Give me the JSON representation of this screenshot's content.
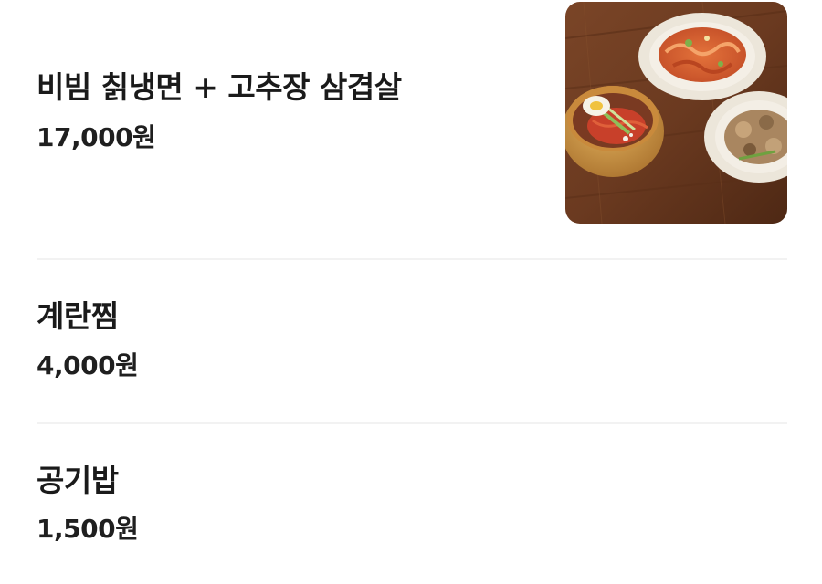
{
  "menu": {
    "items": [
      {
        "name": "비빔 칡냉면 + 고추장 삼겹살",
        "price": "17,000원",
        "image": "food-photo-bibim-naengmyeon-samgyeopsal"
      },
      {
        "name": "계란찜",
        "price": "4,000원"
      },
      {
        "name": "공기밥",
        "price": "1,500원"
      }
    ]
  },
  "colors": {
    "divider": "#f2f2f2",
    "text": "#1a1a1a",
    "table_wood": "#6b3b22"
  }
}
